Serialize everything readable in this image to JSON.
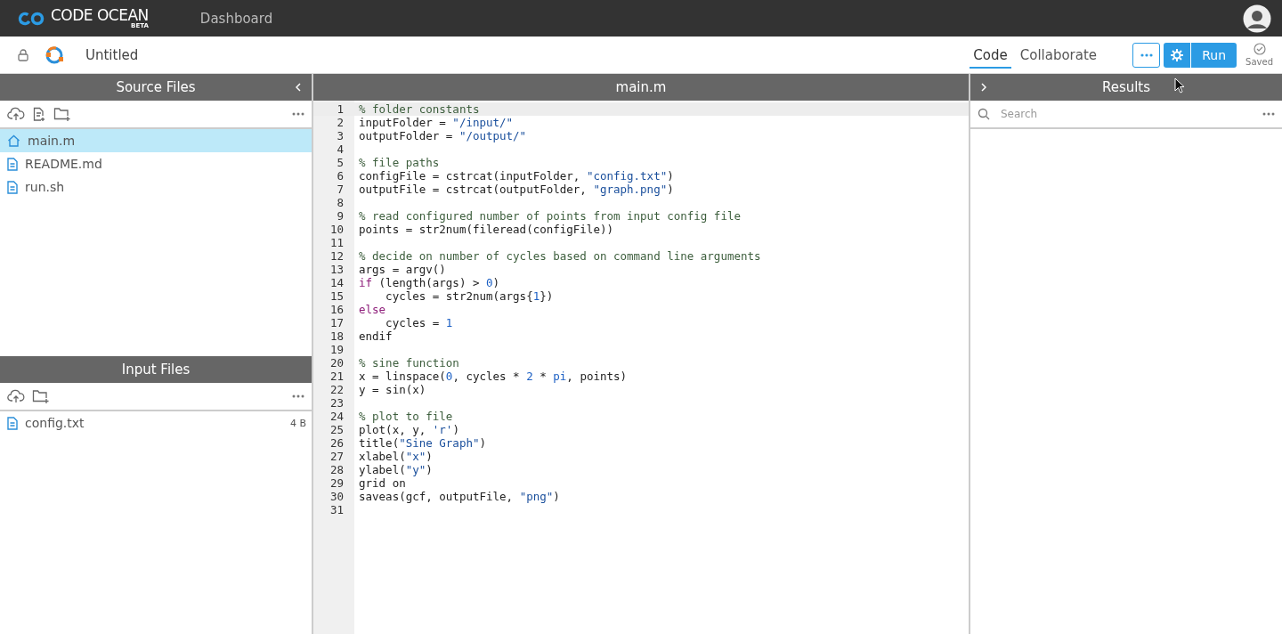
{
  "header": {
    "logo": "CODE OCEAN",
    "logo_badge": "BETA",
    "nav": "Dashboard"
  },
  "toolbar": {
    "title": "Untitled",
    "tabs": [
      {
        "label": "Code",
        "selected": true
      },
      {
        "label": "Collaborate",
        "selected": false
      }
    ],
    "run_button": "Run",
    "save_status": "Saved"
  },
  "source_files": {
    "title": "Source Files",
    "files": [
      {
        "name": "main.m",
        "kind": "home",
        "selected": true
      },
      {
        "name": "README.md",
        "kind": "file",
        "selected": false
      },
      {
        "name": "run.sh",
        "kind": "file",
        "selected": false
      }
    ]
  },
  "input_files": {
    "title": "Input Files",
    "files": [
      {
        "name": "config.txt",
        "size": "4 B"
      }
    ]
  },
  "editor": {
    "title": "main.m",
    "lines": [
      {
        "number": "1",
        "current": true,
        "tokens": [
          {
            "kind": "comment",
            "t": "% folder constants"
          }
        ]
      },
      {
        "number": "2",
        "current": false,
        "tokens": [
          {
            "kind": "plain",
            "t": "inputFolder = "
          },
          {
            "kind": "string",
            "t": "\"/input/\""
          }
        ]
      },
      {
        "number": "3",
        "current": false,
        "tokens": [
          {
            "kind": "plain",
            "t": "outputFolder = "
          },
          {
            "kind": "string",
            "t": "\"/output/\""
          }
        ]
      },
      {
        "number": "4",
        "current": false
      },
      {
        "number": "5",
        "current": false,
        "tokens": [
          {
            "kind": "comment",
            "t": "% file paths"
          }
        ]
      },
      {
        "number": "6",
        "current": false,
        "tokens": [
          {
            "kind": "plain",
            "t": "configFile = cstrcat(inputFolder, "
          },
          {
            "kind": "string",
            "t": "\"config.txt\""
          },
          {
            "kind": "plain",
            "t": ")"
          }
        ]
      },
      {
        "number": "7",
        "current": false,
        "tokens": [
          {
            "kind": "plain",
            "t": "outputFile = cstrcat(outputFolder, "
          },
          {
            "kind": "string",
            "t": "\"graph.png\""
          },
          {
            "kind": "plain",
            "t": ")"
          }
        ]
      },
      {
        "number": "8",
        "current": false
      },
      {
        "number": "9",
        "current": false,
        "tokens": [
          {
            "kind": "comment",
            "t": "% read configured number of points from input config file"
          }
        ]
      },
      {
        "number": "10",
        "current": false,
        "tokens": [
          {
            "kind": "plain",
            "t": "points = str2num(fileread(configFile))"
          }
        ]
      },
      {
        "number": "11",
        "current": false
      },
      {
        "number": "12",
        "current": false,
        "tokens": [
          {
            "kind": "comment",
            "t": "% decide on number of cycles based on command line arguments"
          }
        ]
      },
      {
        "number": "13",
        "current": false,
        "tokens": [
          {
            "kind": "plain",
            "t": "args = argv()"
          }
        ]
      },
      {
        "number": "14",
        "current": false,
        "tokens": [
          {
            "kind": "keyword",
            "t": "if"
          },
          {
            "kind": "plain",
            "t": " (length(args) > "
          },
          {
            "kind": "number",
            "t": "0"
          },
          {
            "kind": "plain",
            "t": ")"
          }
        ]
      },
      {
        "number": "15",
        "current": false,
        "tokens": [
          {
            "kind": "plain",
            "t": "    cycles = str2num(args{"
          },
          {
            "kind": "number",
            "t": "1"
          },
          {
            "kind": "plain",
            "t": "})"
          }
        ]
      },
      {
        "number": "16",
        "current": false,
        "tokens": [
          {
            "kind": "keyword",
            "t": "else"
          }
        ]
      },
      {
        "number": "17",
        "current": false,
        "tokens": [
          {
            "kind": "plain",
            "t": "    cycles = "
          },
          {
            "kind": "number",
            "t": "1"
          }
        ]
      },
      {
        "number": "18",
        "current": false,
        "tokens": [
          {
            "kind": "plain",
            "t": "endif"
          }
        ]
      },
      {
        "number": "19",
        "current": false
      },
      {
        "number": "20",
        "current": false,
        "tokens": [
          {
            "kind": "comment",
            "t": "% sine function"
          }
        ]
      },
      {
        "number": "21",
        "current": false,
        "tokens": [
          {
            "kind": "plain",
            "t": "x = linspace("
          },
          {
            "kind": "number",
            "t": "0"
          },
          {
            "kind": "plain",
            "t": ", cycles * "
          },
          {
            "kind": "number",
            "t": "2"
          },
          {
            "kind": "plain",
            "t": " * "
          },
          {
            "kind": "number",
            "t": "pi"
          },
          {
            "kind": "plain",
            "t": ", points)"
          }
        ]
      },
      {
        "number": "22",
        "current": false,
        "tokens": [
          {
            "kind": "plain",
            "t": "y = sin(x)"
          }
        ]
      },
      {
        "number": "23",
        "current": false
      },
      {
        "number": "24",
        "current": false,
        "tokens": [
          {
            "kind": "comment",
            "t": "% plot to file"
          }
        ]
      },
      {
        "number": "25",
        "current": false,
        "tokens": [
          {
            "kind": "plain",
            "t": "plot(x, y, "
          },
          {
            "kind": "string",
            "t": "'r'"
          },
          {
            "kind": "plain",
            "t": ")"
          }
        ]
      },
      {
        "number": "26",
        "current": false,
        "tokens": [
          {
            "kind": "plain",
            "t": "title("
          },
          {
            "kind": "string",
            "t": "\"Sine Graph\""
          },
          {
            "kind": "plain",
            "t": ")"
          }
        ]
      },
      {
        "number": "27",
        "current": false,
        "tokens": [
          {
            "kind": "plain",
            "t": "xlabel("
          },
          {
            "kind": "string",
            "t": "\"x\""
          },
          {
            "kind": "plain",
            "t": ")"
          }
        ]
      },
      {
        "number": "28",
        "current": false,
        "tokens": [
          {
            "kind": "plain",
            "t": "ylabel("
          },
          {
            "kind": "string",
            "t": "\"y\""
          },
          {
            "kind": "plain",
            "t": ")"
          }
        ]
      },
      {
        "number": "29",
        "current": false,
        "tokens": [
          {
            "kind": "plain",
            "t": "grid on"
          }
        ]
      },
      {
        "number": "30",
        "current": false,
        "tokens": [
          {
            "kind": "plain",
            "t": "saveas(gcf, outputFile, "
          },
          {
            "kind": "string",
            "t": "\"png\""
          },
          {
            "kind": "plain",
            "t": ")"
          }
        ]
      },
      {
        "number": "31",
        "current": false
      }
    ]
  },
  "results": {
    "title": "Results",
    "search": {
      "placeholder": "Search"
    }
  }
}
